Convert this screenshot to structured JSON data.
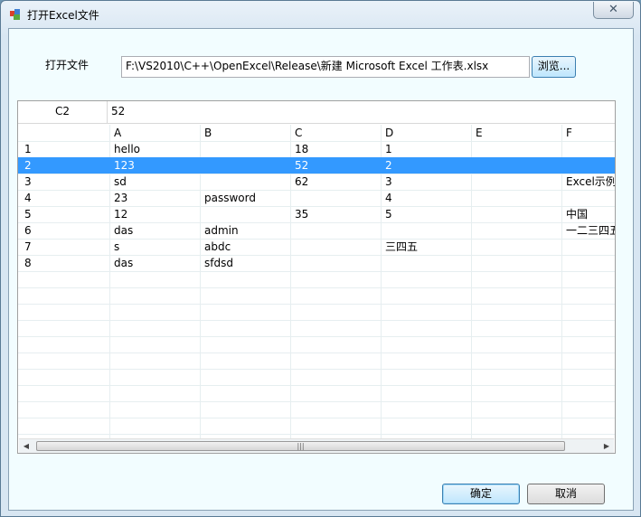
{
  "window": {
    "title": "打开Excel文件",
    "close_symbol": "✕",
    "app_icon": "excel-app-icon"
  },
  "form": {
    "label": "打开文件",
    "path_value": "F:\\VS2010\\C++\\OpenExcel\\Release\\新建 Microsoft Excel 工作表.xlsx",
    "browse_label": "浏览..."
  },
  "cell_bar": {
    "ref": "C2",
    "value": "52"
  },
  "grid": {
    "columns": [
      "",
      "A",
      "B",
      "C",
      "D",
      "E",
      "F"
    ],
    "rows": [
      [
        "1",
        "hello",
        "",
        "18",
        "1",
        "",
        ""
      ],
      [
        "2",
        "123",
        "",
        "52",
        "2",
        "",
        ""
      ],
      [
        "3",
        "sd",
        "",
        "62",
        "3",
        "",
        "Excel示例"
      ],
      [
        "4",
        "23",
        "password",
        "",
        "4",
        "",
        ""
      ],
      [
        "5",
        "12",
        "",
        "35",
        "5",
        "",
        "中国"
      ],
      [
        "6",
        "das",
        "admin",
        "",
        "",
        "",
        "一二三四五"
      ],
      [
        "7",
        "s",
        "abdc",
        "",
        "三四五",
        "",
        ""
      ],
      [
        "8",
        "das",
        "sfdsd",
        "",
        "",
        "",
        ""
      ]
    ],
    "selected_row": 2,
    "scroll": {
      "left_arrow": "◀",
      "right_arrow": "▶",
      "thumb_grip": "|||"
    }
  },
  "buttons": {
    "ok": "确定",
    "cancel": "取消"
  },
  "colors": {
    "selection": "#3399ff",
    "dialog_bg": "#f2fdff"
  }
}
